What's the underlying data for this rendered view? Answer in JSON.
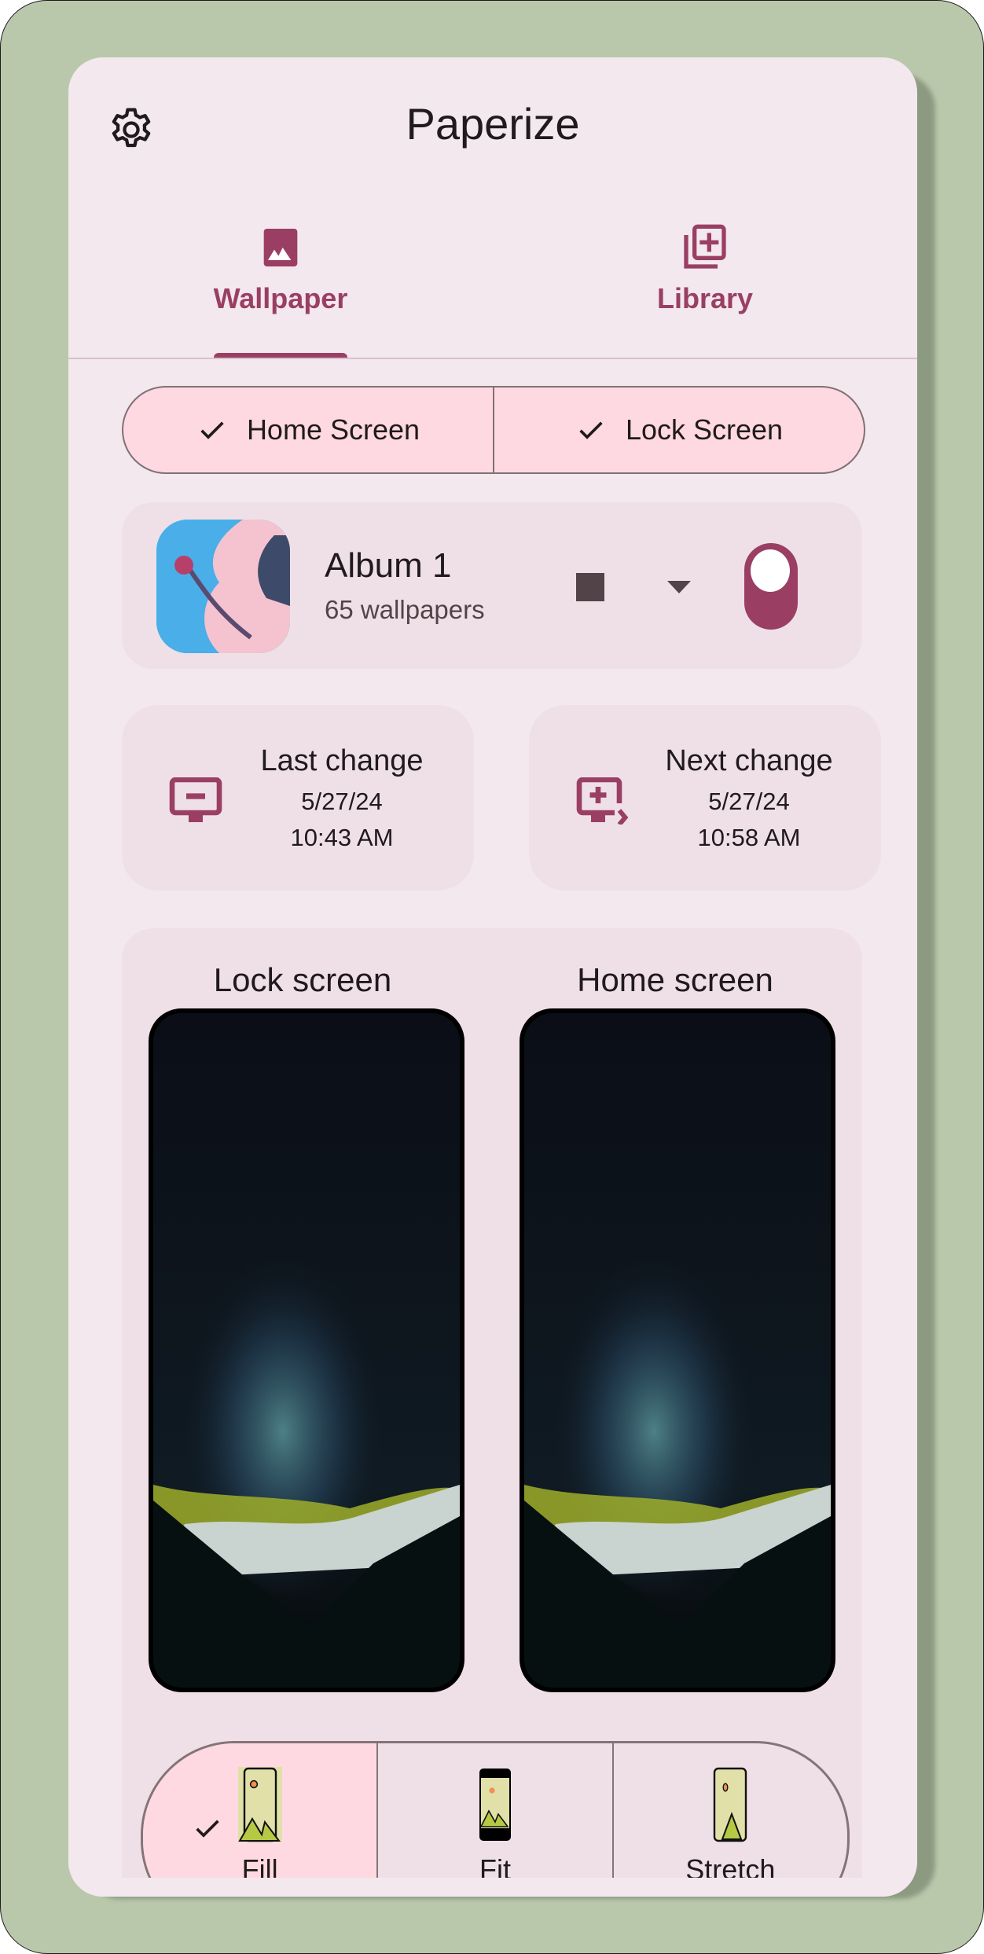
{
  "header": {
    "title": "Paperize",
    "settings_icon": "gear-icon"
  },
  "tabs": [
    {
      "label": "Wallpaper",
      "icon": "image-icon",
      "selected": true
    },
    {
      "label": "Library",
      "icon": "library-add-icon",
      "selected": false
    }
  ],
  "screen_toggle": {
    "options": [
      {
        "label": "Home Screen",
        "checked": true
      },
      {
        "label": "Lock Screen",
        "checked": true
      }
    ]
  },
  "album": {
    "name": "Album 1",
    "count": "65 wallpapers",
    "stop_icon": "stop-icon",
    "dropdown_icon": "arrow-drop-down-icon",
    "enabled": true
  },
  "changes": {
    "last": {
      "title": "Last change",
      "date": "5/27/24",
      "time": "10:43 AM",
      "icon": "desktop-minus-icon"
    },
    "next": {
      "title": "Next change",
      "date": "5/27/24",
      "time": "10:58 AM",
      "icon": "desktop-add-next-icon"
    }
  },
  "preview": {
    "lock_label": "Lock screen",
    "home_label": "Home screen"
  },
  "scaling": {
    "options": [
      {
        "label": "Fill",
        "selected": true
      },
      {
        "label": "Fit",
        "selected": false
      },
      {
        "label": "Stretch",
        "selected": false
      }
    ]
  },
  "colors": {
    "primary": "#9a3f63",
    "surface": "#f3e8ee",
    "surface_container": "#efe0e7",
    "selected_container": "#ffd9e1",
    "frame_background": "#b9c8ab"
  }
}
